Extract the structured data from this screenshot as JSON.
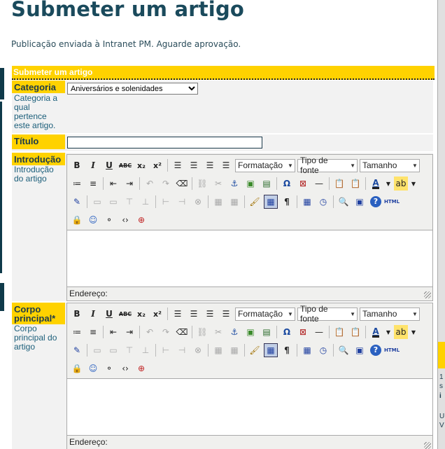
{
  "page": {
    "title": "Submeter um artigo",
    "notice": "Publicação enviada à Intranet PM. Aguarde aprovação."
  },
  "form": {
    "header": "Submeter um artigo",
    "categoria": {
      "label": "Categoria",
      "desc": "Categoria a qual pertence este artigo.",
      "selected": "Aniversários e solenidades"
    },
    "titulo": {
      "label": "Título",
      "value": ""
    },
    "introducao": {
      "label": "Introdução",
      "desc": "Introdução do artigo"
    },
    "corpo": {
      "label": "Corpo principal*",
      "desc": "Corpo principal do artigo"
    }
  },
  "editor": {
    "formatacao": "Formatação",
    "tipo_fonte": "Tipo de fonte",
    "tamanho": "Tamanho",
    "status_label": "Endereço:",
    "html_label": "HTML",
    "bold": "B",
    "italic": "I",
    "underline": "U",
    "strike": "ABC",
    "subscript": "x₂",
    "superscript": "x²"
  },
  "right_edge": {
    "lines": [
      "1",
      "s",
      "i",
      "U",
      "V"
    ]
  }
}
